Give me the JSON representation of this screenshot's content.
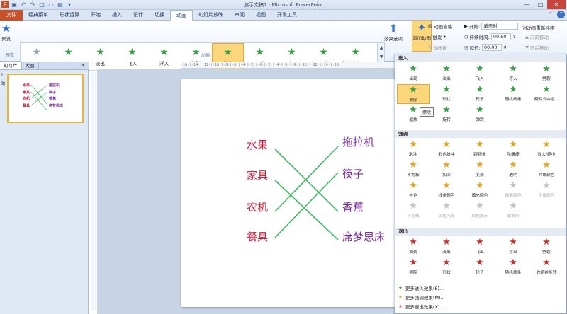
{
  "window": {
    "title": "演示文稿1 - Microsoft PowerPoint"
  },
  "tabs": [
    "文件",
    "经典菜单",
    "形状运算",
    "开始",
    "插入",
    "设计",
    "切换",
    "动画",
    "幻灯片放映",
    "审阅",
    "视图",
    "开发工具"
  ],
  "active_tab": "动画",
  "ribbon": {
    "preview_label": "预览",
    "preview_group": "预览",
    "animation_group": "动画",
    "gallery": [
      {
        "label": "无",
        "icon": "star-icon",
        "color": "#9aa4b2"
      },
      {
        "label": "出现",
        "icon": "star-icon",
        "color": "#3aa04a"
      },
      {
        "label": "淡出",
        "icon": "star-icon",
        "color": "#3aa04a"
      },
      {
        "label": "飞入",
        "icon": "star-icon",
        "color": "#3aa04a"
      },
      {
        "label": "浮入",
        "icon": "star-icon",
        "color": "#3aa04a"
      },
      {
        "label": "劈裂",
        "icon": "star-icon",
        "color": "#3aa04a"
      },
      {
        "label": "擦除",
        "icon": "star-icon",
        "color": "#3aa04a"
      },
      {
        "label": "形状",
        "icon": "star-icon",
        "color": "#3aa04a"
      },
      {
        "label": "轮子",
        "icon": "star-icon",
        "color": "#3aa04a"
      },
      {
        "label": "随机线条",
        "icon": "star-icon",
        "color": "#3aa04a"
      },
      {
        "label": "翻转式由远...",
        "icon": "star-icon",
        "color": "#3aa04a"
      }
    ],
    "effect_options": "效果选项",
    "add_animation": "添加动画",
    "animation_pane": "动画窗格",
    "trigger": "触发",
    "animation_painter": "动画刷",
    "start_label": "开始:",
    "start_value": "单击时",
    "duration_label": "持续时间:",
    "duration_value": "00.50",
    "delay_label": "延迟:",
    "delay_value": "00.00",
    "reorder_label": "对动画重新排序",
    "move_earlier": "向前移动",
    "move_later": "向后移动"
  },
  "sidebar": {
    "tab_slides": "幻灯片",
    "tab_outline": "大纲",
    "slide_number": "1",
    "slide_mark": "动"
  },
  "ruler": "·16·|·14·|·12·|·10·|·8·|·6·|·4·|·2·|·0·|·2·|·4·|·6·|·8·|·10·|·12·|·14·|·16·|",
  "slide": {
    "left": [
      "水果",
      "家具",
      "农机",
      "餐具"
    ],
    "right": [
      "拖拉机",
      "筷子",
      "香蕉",
      "席梦思床"
    ]
  },
  "panel": {
    "sections": [
      "进入",
      "强调",
      "退出"
    ],
    "entrance": [
      "出现",
      "淡出",
      "飞入",
      "浮入",
      "劈裂",
      "擦除",
      "形状",
      "轮子",
      "随机线条",
      "翻转式由远...",
      "缩放",
      "旋转",
      "弹跳"
    ],
    "emphasis": [
      "脉冲",
      "彩色脉冲",
      "跷跷板",
      "陀螺旋",
      "放大/缩小",
      "不饱和",
      "加深",
      "变淡",
      "透明",
      "对象颜色",
      "补色",
      "线条颜色",
      "填充颜色",
      "画笔颜色",
      "字体颜色",
      "下划线",
      "加粗闪烁",
      "加粗展示",
      "波浪形"
    ],
    "exit": [
      "消失",
      "淡出",
      "飞出",
      "浮出",
      "劈裂",
      "擦除",
      "形状",
      "轮子",
      "随机线条",
      "收缩并旋转"
    ],
    "more": [
      "更多进入效果(E)...",
      "更多强调效果(M)...",
      "更多退出效果(X)..."
    ],
    "tooltip": "擦除"
  }
}
